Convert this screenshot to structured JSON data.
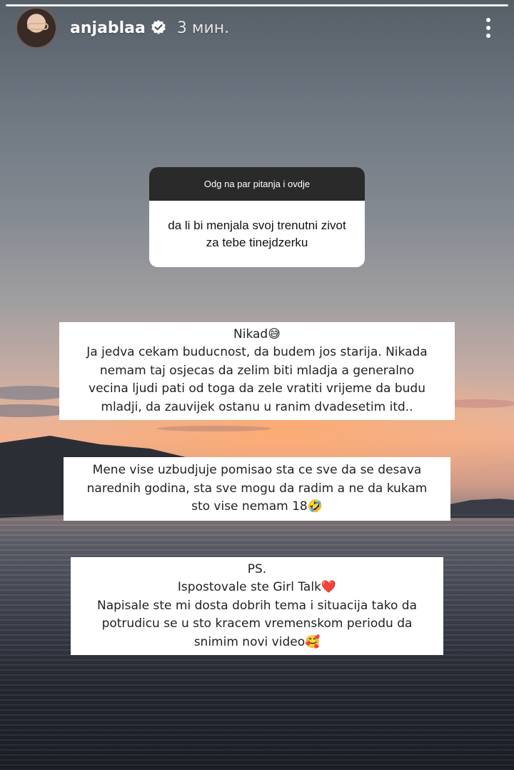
{
  "story": {
    "username": "anjablaa",
    "time": "3 мин.",
    "avatar": "avatar",
    "icons": {
      "verified": "verified-badge-icon",
      "more": "more-vertical-icon"
    }
  },
  "question_sticker": {
    "prompt": "Odg na par pitanja i ovdje",
    "question": "da li bi menjala svoj trenutni zivot za tebe tinejdzerku"
  },
  "answers": [
    {
      "lines": [
        "Nikad😅",
        "Ja jedva cekam buducnost, da budem jos starija. Nikada",
        "nemam taj osjecas da zelim biti mladja a generalno",
        "vecina ljudi pati od toga da zele vratiti vrijeme da budu",
        "mladji, da zauvijek ostanu u ranim dvadesetim itd.."
      ]
    },
    {
      "lines": [
        "Mene vise uzbudjuje pomisao sta ce sve da se desava",
        "narednih godina, sta sve mogu da radim a ne da kukam",
        "sto vise nemam 18🤣"
      ]
    },
    {
      "lines": [
        "PS.",
        "Ispostovale ste Girl Talk❤️",
        "Napisale ste mi dosta dobrih tema i situacija tako da",
        "potrudicu se u sto kracem vremenskom periodu da",
        "snimim novi video🥰"
      ]
    }
  ],
  "colors": {
    "verified_blue": "#3897f0",
    "question_header": "#2a2a2a",
    "box_bg": "#ffffff"
  }
}
